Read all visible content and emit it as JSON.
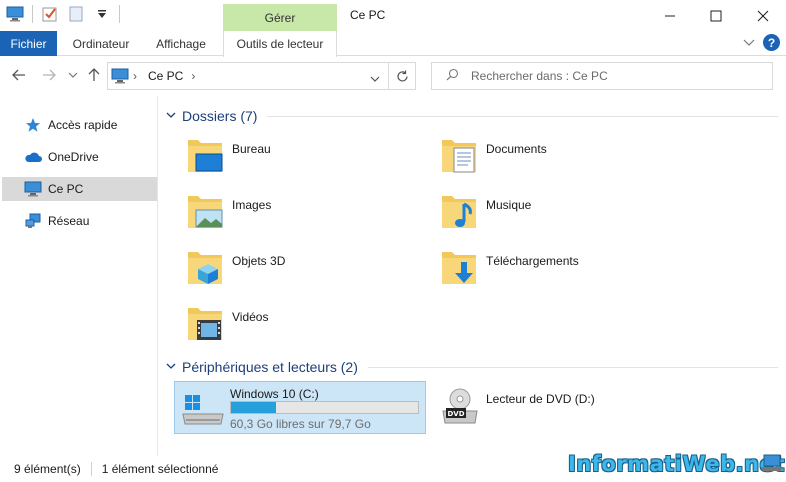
{
  "window": {
    "title": "Ce PC",
    "context_tab": "Gérer",
    "controls": {
      "minimize": "─",
      "maximize": "☐",
      "close": "✕"
    }
  },
  "ribbon": {
    "tabs": [
      "Fichier",
      "Ordinateur",
      "Affichage",
      "Outils de lecteur"
    ],
    "help": "?",
    "expand": "⌄"
  },
  "nav": {
    "back": "←",
    "forward": "→",
    "recent": "⌄",
    "up": "↑",
    "address_path": "Ce PC",
    "address_sep": "›",
    "address_dropdown": "⌄",
    "refresh": "↻",
    "search_placeholder": "Rechercher dans : Ce PC"
  },
  "sidebar": {
    "items": [
      {
        "label": "Accès rapide",
        "icon": "star-icon"
      },
      {
        "label": "OneDrive",
        "icon": "cloud-icon"
      },
      {
        "label": "Ce PC",
        "icon": "computer-icon",
        "selected": true
      },
      {
        "label": "Réseau",
        "icon": "network-icon"
      }
    ]
  },
  "groups": {
    "folders_title": "Dossiers (7)",
    "devices_title": "Périphériques et lecteurs (2)"
  },
  "folders": [
    {
      "label": "Bureau",
      "icon": "desktop-folder-icon"
    },
    {
      "label": "Documents",
      "icon": "documents-folder-icon"
    },
    {
      "label": "Images",
      "icon": "pictures-folder-icon"
    },
    {
      "label": "Musique",
      "icon": "music-folder-icon"
    },
    {
      "label": "Objets 3D",
      "icon": "3d-objects-folder-icon"
    },
    {
      "label": "Téléchargements",
      "icon": "downloads-folder-icon"
    },
    {
      "label": "Vidéos",
      "icon": "videos-folder-icon"
    }
  ],
  "drives": [
    {
      "label": "Windows 10 (C:)",
      "free_text": "60,3 Go libres sur 79,7 Go",
      "used_fraction": 0.24,
      "selected": true
    },
    {
      "label": "Lecteur de DVD (D:)",
      "badge": "DVD"
    }
  ],
  "status": {
    "count": "9 élément(s)",
    "selection": "1 élément sélectionné"
  },
  "watermark": "InformatiWeb.net",
  "colors": {
    "accent": "#1a63b5",
    "context_tab_bg": "#c7e8a8",
    "group_title": "#1e3f7a",
    "selection_bg": "#cce6f8",
    "drive_bar": "#26a0da",
    "folder": "#f2c85b"
  }
}
